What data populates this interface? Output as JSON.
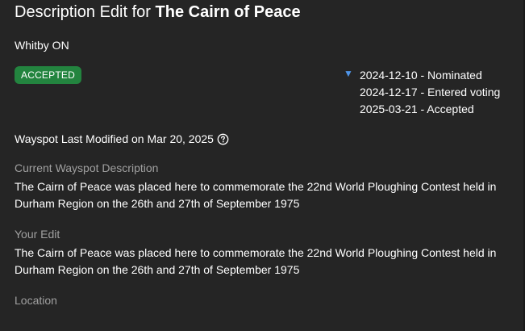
{
  "header": {
    "title_prefix": "Description Edit for ",
    "title_name": "The Cairn of Peace",
    "city": "Whitby ON"
  },
  "status": {
    "badge_label": "ACCEPTED",
    "badge_color": "#23843f"
  },
  "timeline": {
    "toggle_icon": "triangle-down-icon",
    "toggle_glyph": "▼",
    "entries": [
      "2024-12-10 - Nominated",
      "2024-12-17 - Entered voting",
      "2025-03-21 - Accepted"
    ]
  },
  "wayspot": {
    "last_modified": "Wayspot Last Modified on Mar 20, 2025",
    "help_icon": "question-circle-icon"
  },
  "sections": {
    "current_label": "Current Wayspot Description",
    "current_text": "The Cairn of Peace was placed here to commemorate the 22nd World Ploughing Contest held in Durham Region on the 26th and 27th of September 1975",
    "edit_label": "Your Edit",
    "edit_text": "The Cairn of Peace was placed here to commemorate the 22nd World Ploughing Contest held in Durham Region on the 26th and 27th of September 1975",
    "location_label": "Location"
  },
  "colors": {
    "background": "#252525",
    "text": "#ffffff",
    "muted": "#a0a0a0",
    "accent_blue": "#4f95e8"
  }
}
